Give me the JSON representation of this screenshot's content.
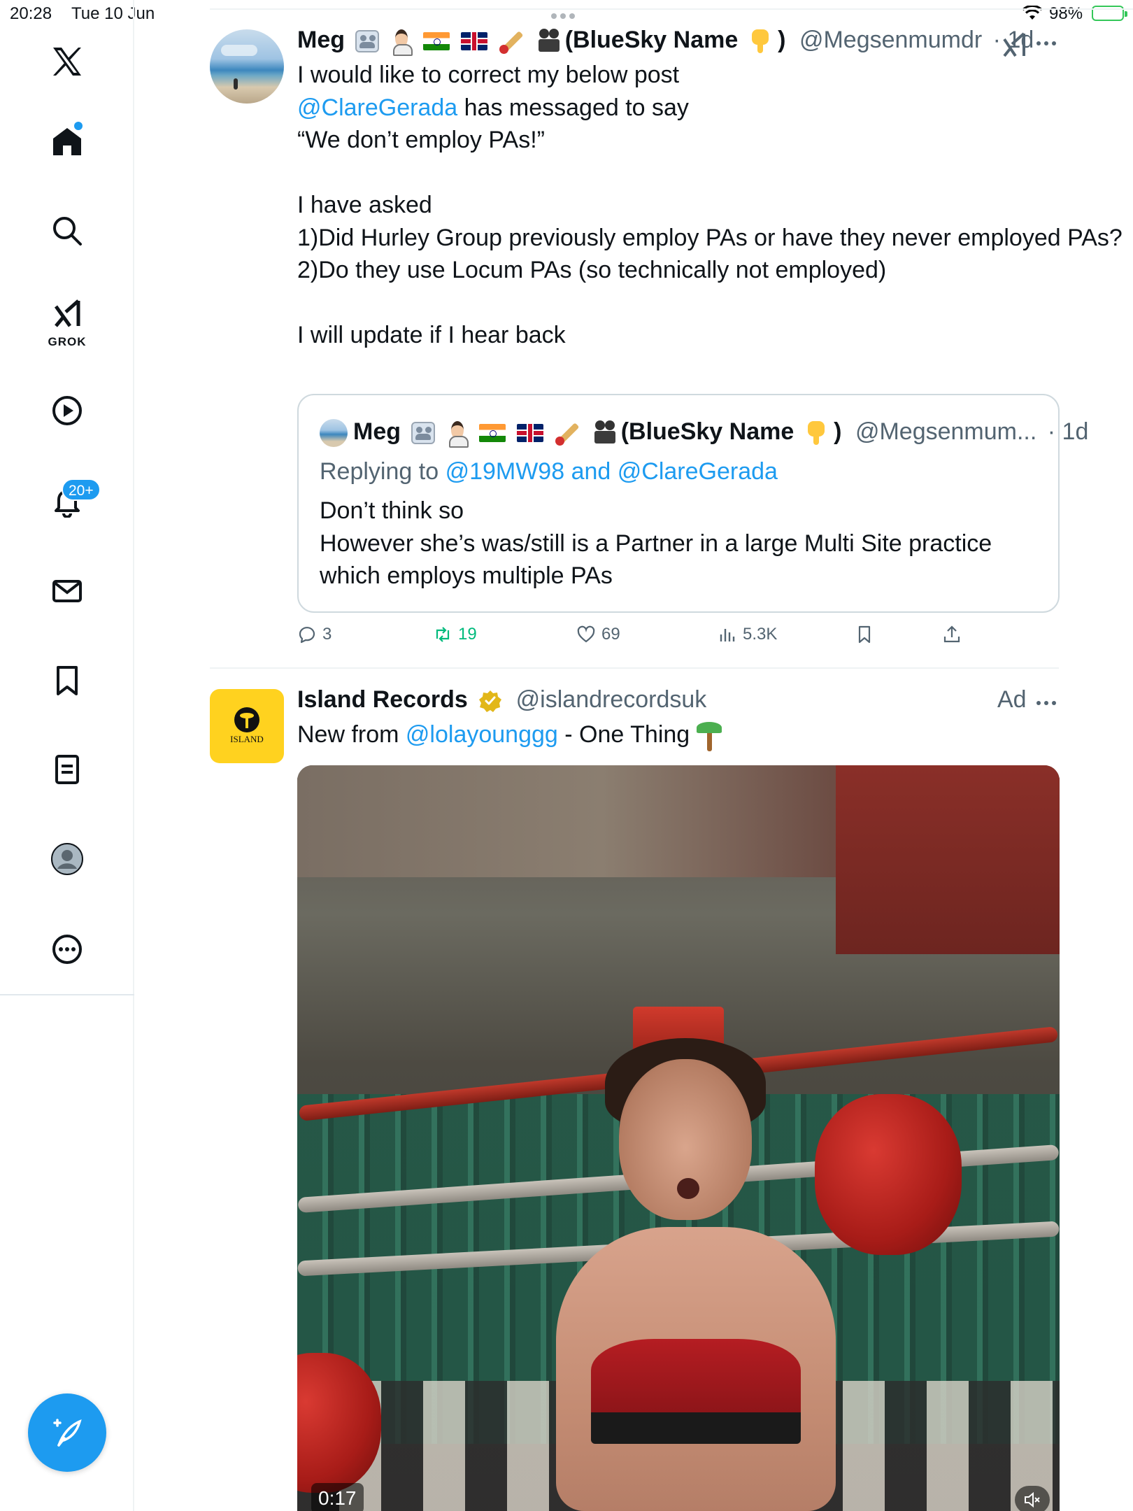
{
  "status_bar": {
    "time": "20:28",
    "date": "Tue 10 Jun",
    "battery": "98%"
  },
  "sidebar": {
    "items": [
      {
        "name": "x-logo",
        "label": ""
      },
      {
        "name": "home",
        "label": ""
      },
      {
        "name": "explore",
        "label": ""
      },
      {
        "name": "grok",
        "label": "GROK"
      },
      {
        "name": "video",
        "label": ""
      },
      {
        "name": "notifications",
        "label": ""
      },
      {
        "name": "messages",
        "label": ""
      },
      {
        "name": "bookmarks",
        "label": ""
      },
      {
        "name": "lists",
        "label": ""
      },
      {
        "name": "profile",
        "label": ""
      },
      {
        "name": "more",
        "label": ""
      }
    ],
    "notification_count": "20+",
    "grok_label": "GROK"
  },
  "tweet": {
    "author_name": "Meg",
    "author_suffix": "(BlueSky Name",
    "author_close": ")",
    "handle": "@Megsenmumdr",
    "time": "· 1d",
    "lines": [
      "I would like to correct my below post",
      "has messaged to say",
      "“We don’t employ PAs!”",
      "",
      "I have asked",
      "1)Did Hurley Group previously employ PAs or have they never employed PAs?",
      "2)Do they use Locum PAs (so technically not employed)",
      "",
      "I will update if I hear back"
    ],
    "mention": "@ClareGerada",
    "quote": {
      "author_name": "Meg",
      "author_suffix": "(BlueSky Name",
      "author_close": ")",
      "handle": "@Megsenmum...",
      "time": "· 1d",
      "replying_prefix": "Replying to",
      "replying_to": "@19MW98 and @ClareGerada",
      "lines": [
        "Don’t think so",
        "However she’s was/still is a Partner in a large Multi Site practice which employs multiple PAs"
      ]
    },
    "stats": {
      "replies": "3",
      "retweets": "19",
      "likes": "69",
      "views": "5.3K"
    }
  },
  "ad_tweet": {
    "author_name": "Island Records",
    "handle": "@islandrecordsuk",
    "ad_label": "Ad",
    "text_prefix": "New from",
    "mention": "@lolayounggg",
    "text_suffix": "- One Thing",
    "avatar_text": "ISLAND",
    "video": {
      "time": "0:17",
      "muted": true
    }
  },
  "colors": {
    "accent": "#1d9bf0",
    "retweet": "#00ba7c",
    "secondary_text": "#536471",
    "divider": "#eff3f4"
  }
}
